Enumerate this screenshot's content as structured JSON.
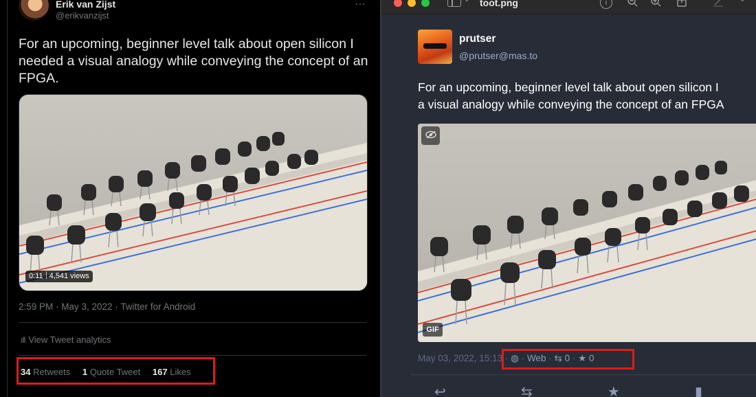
{
  "tweet": {
    "author_name": "Erik van Zijst",
    "author_handle": "@erikvanzijst",
    "more_icon": "…",
    "text": "For an upcoming, beginner level talk about open silicon I needed a visual analogy while conveying the concept of an FPGA.",
    "video_time": "0:11",
    "video_views": "4,541 views",
    "meta": "2:59 PM · May 3, 2022 · Twitter for Android",
    "analytics_label": "View Tweet analytics",
    "retweets_count": "34",
    "retweets_label": "Retweets",
    "quote_count": "1",
    "quote_label": "Quote Tweet",
    "likes_count": "167",
    "likes_label": "Likes"
  },
  "viewer": {
    "title": "toot.png",
    "chevron": "⌄",
    "toolbar_icons": [
      "sidebar-icon",
      "info-icon",
      "zoom-out-icon",
      "zoom-in-icon",
      "share-icon",
      "markup-icon"
    ]
  },
  "toot": {
    "display_name": "prutser",
    "handle": "@prutser@mas.to",
    "text_line1": "For an upcoming, beginner level talk about open silicon I",
    "text_line2": "a visual analogy while conveying the concept of an FPGA",
    "gif_label": "GIF",
    "date": "May 03, 2022, 15:13",
    "sep": "·",
    "visibility_icon": "◍",
    "app": "Web",
    "boost_icon": "⇆",
    "boosts": "0",
    "star_icon": "★",
    "favourites": "0"
  },
  "colors": {
    "highlight": "#e01a1a",
    "twitter_bg": "#000000",
    "mastodon_bg": "#282c37"
  }
}
